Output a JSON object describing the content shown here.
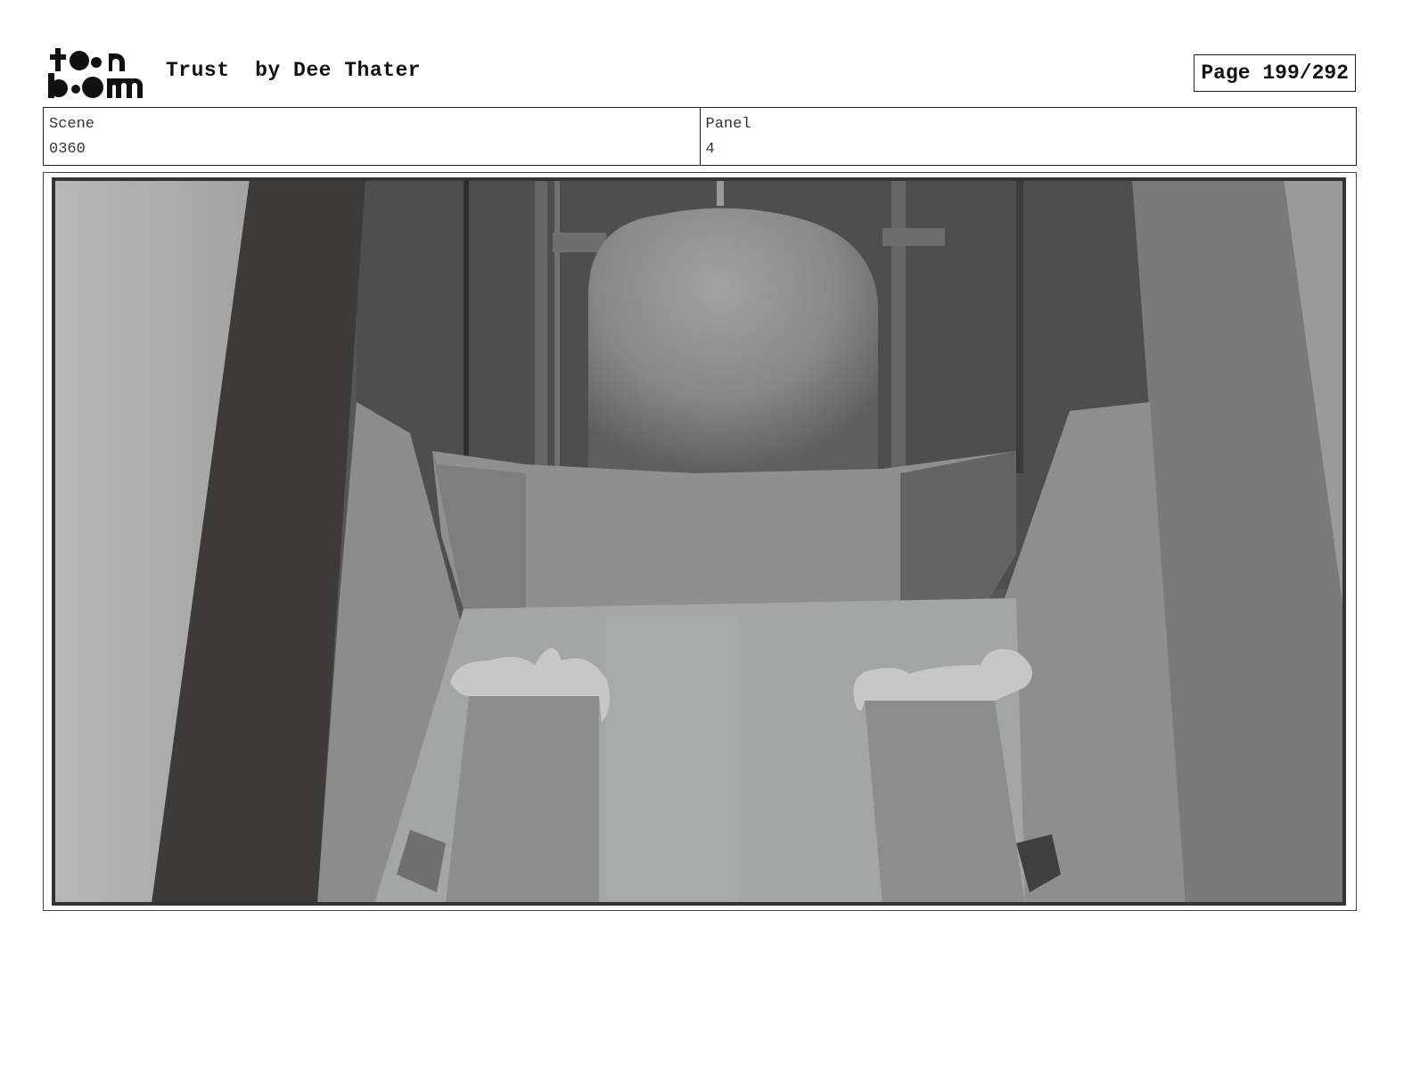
{
  "header": {
    "logo_text": "toon boom",
    "title": "Trust  by Dee Thater",
    "page": "Page 199/292"
  },
  "info": {
    "scene_label": "Scene",
    "scene_value": "0360",
    "panel_label": "Panel",
    "panel_value": "4"
  },
  "colors": {
    "border": "#222222",
    "panel_background": "#5a5a5a"
  }
}
